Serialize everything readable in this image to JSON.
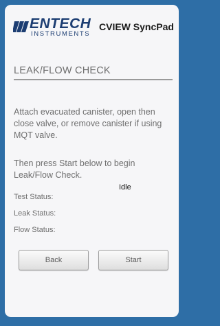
{
  "header": {
    "logo_main": "ENTECH",
    "logo_sub": "INSTRUMENTS",
    "app_title": "CVIEW SyncPad"
  },
  "page": {
    "title": "LEAK/FLOW CHECK",
    "instruction_1": "Attach evacuated canister, open then close valve, or remove canister if using MQT valve.",
    "instruction_2": "Then press Start below to begin Leak/Flow Check."
  },
  "status": {
    "test_label": "Test Status:",
    "test_value": "Idle",
    "leak_label": "Leak Status:",
    "flow_label": "Flow Status:"
  },
  "buttons": {
    "back_label": "Back",
    "start_label": "Start"
  },
  "icons": {
    "logo": "entech-logo-icon"
  },
  "colors": {
    "background": "#2e6ea6",
    "panel": "#f6f6f8",
    "brand": "#1c3d72",
    "text_muted": "#6e6e6e"
  }
}
